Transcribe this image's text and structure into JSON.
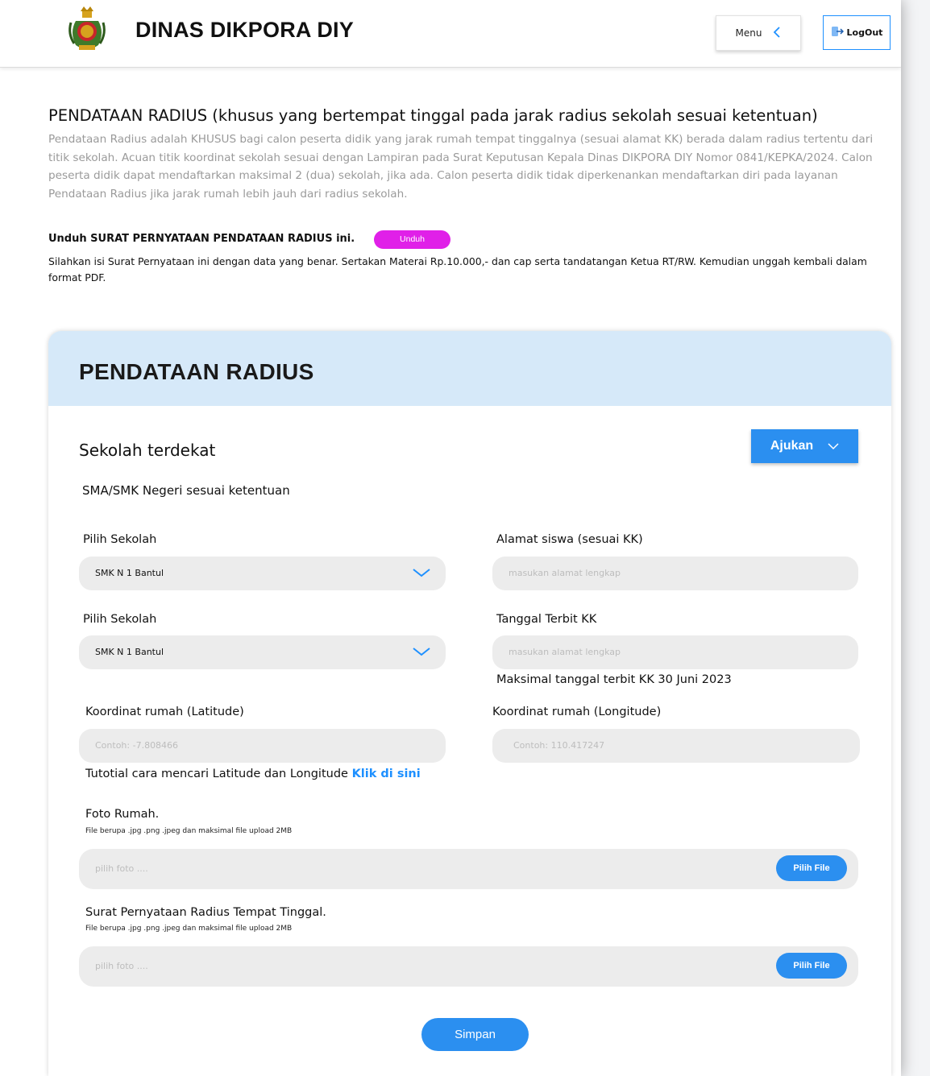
{
  "header": {
    "brand": "DINAS DIKPORA DIY",
    "menu_label": "Menu",
    "logout_label": "LogOut"
  },
  "intro": {
    "title": "PENDATAAN RADIUS (khusus yang bertempat tinggal pada jarak radius sekolah sesuai ketentuan)",
    "description": "Pendataan Radius adalah KHUSUS bagi calon peserta didik yang jarak rumah tempat tinggalnya (sesuai alamat KK) berada dalam radius tertentu dari titik sekolah. Acuan titik koordinat sekolah sesuai dengan Lampiran pada Surat Keputusan Kepala Dinas DIKPORA DIY Nomor 0841/KEPKA/2024. Calon peserta didik dapat mendaftarkan maksimal 2 (dua) sekolah, jika ada. Calon peserta didik tidak diperkenankan mendaftarkan diri pada layanan Pendataan Radius jika jarak rumah lebih jauh dari radius sekolah.",
    "download_label": "Unduh SURAT PERNYATAAN PENDATAAN RADIUS ini.",
    "download_button": "Unduh",
    "download_note": "Silahkan isi Surat Pernyataan ini dengan data yang benar. Sertakan Materai Rp.10.000,- dan cap serta tandatangan Ketua RT/RW. Kemudian unggah kembali dalam format PDF."
  },
  "form": {
    "card_title": "PENDATAAN RADIUS",
    "section_title": "Sekolah terdekat",
    "ajukan_label": "Ajukan",
    "subtitle": "SMA/SMK Negeri sesuai ketentuan",
    "school1": {
      "label": "Pilih Sekolah",
      "value": "SMK N 1 Bantul"
    },
    "school2": {
      "label": "Pilih Sekolah",
      "value": "SMK N 1 Bantul"
    },
    "address": {
      "label": "Alamat siswa (sesuai KK)",
      "placeholder": "masukan alamat lengkap"
    },
    "kk_date": {
      "label": "Tanggal Terbit KK",
      "placeholder": "masukan alamat lengkap",
      "note": "Maksimal tanggal terbit KK 30 Juni 2023"
    },
    "latitude": {
      "label": "Koordinat rumah (Latitude)",
      "placeholder": "Contoh: -7.808466"
    },
    "longitude": {
      "label": "Koordinat rumah (Longitude)",
      "placeholder": "Contoh: 110.417247"
    },
    "tutorial_text": "Tutotial cara mencari Latitude dan Longitude",
    "tutorial_link": "Klik di sini",
    "photo": {
      "label": "Foto Rumah.",
      "hint": "File berupa .jpg .png .jpeg dan maksimal file upload 2MB",
      "placeholder": "pilih foto ....",
      "button": "Pilih File"
    },
    "letter": {
      "label": "Surat Pernyataan Radius Tempat Tinggal.",
      "hint": "File berupa .jpg .png .jpeg dan maksimal file upload 2MB",
      "placeholder": "pilih foto ....",
      "button": "Pilih File"
    },
    "save_label": "Simpan"
  },
  "colors": {
    "accent": "#2b8ff0",
    "link": "#1e90ff",
    "download_button": "#e020e8",
    "card_header": "#d6e9f9",
    "field_bg": "#ececec"
  },
  "icons": {
    "logo": "emblem-logo",
    "menu": "chevron-left-icon",
    "logout": "logout-icon",
    "ajukan": "chevron-down-icon",
    "dropdown": "chevron-down-icon"
  }
}
